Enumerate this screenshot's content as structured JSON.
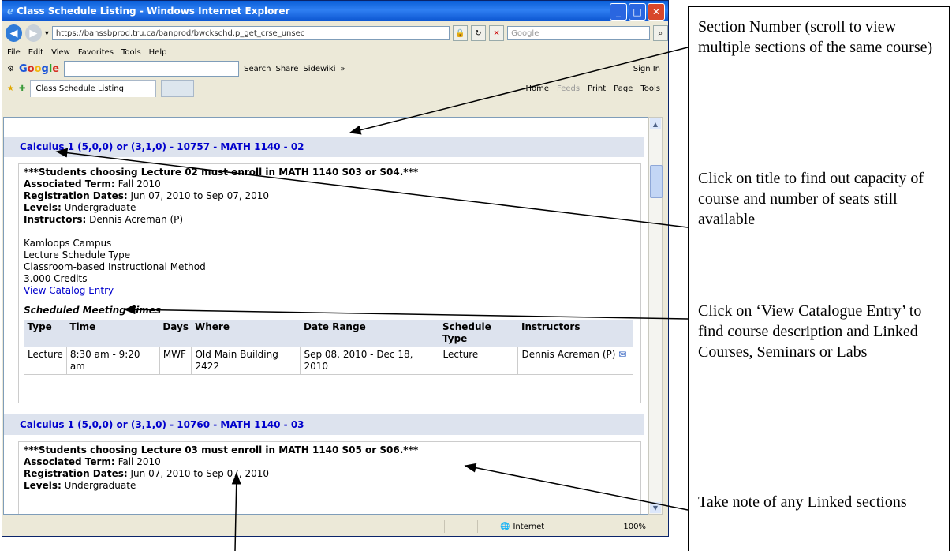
{
  "window": {
    "title": "Class Schedule Listing - Windows Internet Explorer",
    "url": "https://banssbprod.tru.ca/banprod/bwckschd.p_get_crse_unsec",
    "search_placeholder": "Google",
    "menu": [
      "File",
      "Edit",
      "View",
      "Favorites",
      "Tools",
      "Help"
    ],
    "google_toolbar": {
      "search": "Search",
      "share": "Share",
      "sidewiki": "Sidewiki",
      "sign_in": "Sign In"
    },
    "tab_title": "Class Schedule Listing",
    "commands": [
      "Home",
      "Feeds",
      "Print",
      "Page",
      "Tools"
    ],
    "status": {
      "zone": "Internet",
      "zoom": "100%"
    }
  },
  "section1": {
    "title": "Calculus 1 (5,0,0) or (3,1,0) - 10757 - MATH 1140 - 02",
    "note": "***Students choosing Lecture 02 must enroll in MATH 1140 S03 or S04.***",
    "term_label": "Associated Term:",
    "term": "Fall 2010",
    "reg_label": "Registration Dates:",
    "reg": "Jun 07, 2010 to Sep 07, 2010",
    "levels_label": "Levels:",
    "levels": "Undergraduate",
    "instr_label": "Instructors:",
    "instr": "Dennis Acreman (P)",
    "campus": "Kamloops Campus",
    "schedule_type": "Lecture Schedule Type",
    "method": "Classroom-based Instructional Method",
    "credits": "3.000 Credits",
    "catalog_link": "View Catalog Entry",
    "meeting_caption": "Scheduled Meeting Times",
    "headers": [
      "Type",
      "Time",
      "Days",
      "Where",
      "Date Range",
      "Schedule Type",
      "Instructors"
    ],
    "row": [
      "Lecture",
      "8:30 am - 9:20 am",
      "MWF",
      "Old Main Building 2422",
      "Sep 08, 2010 - Dec 18, 2010",
      "Lecture",
      "Dennis Acreman (P)"
    ]
  },
  "section2": {
    "title": "Calculus 1 (5,0,0) or (3,1,0) - 10760 - MATH 1140 - 03",
    "note": "***Students choosing Lecture 03 must enroll in MATH 1140 S05 or S06.***",
    "term_label": "Associated Term:",
    "term": "Fall 2010",
    "reg_label": "Registration Dates:",
    "reg": "Jun 07, 2010 to Sep 07, 2010",
    "levels_label": "Levels:",
    "levels": "Undergraduate"
  },
  "annotations": {
    "section_number": "Section Number (scroll to view multiple sections of the same course)",
    "click_title": "Click on title to find out capacity of course and number of seats still available",
    "catalog": "Click on ‘View Catalogue Entry’ to find course description and Linked Courses, Seminars or Labs",
    "linked": "Take note of any Linked sections"
  }
}
